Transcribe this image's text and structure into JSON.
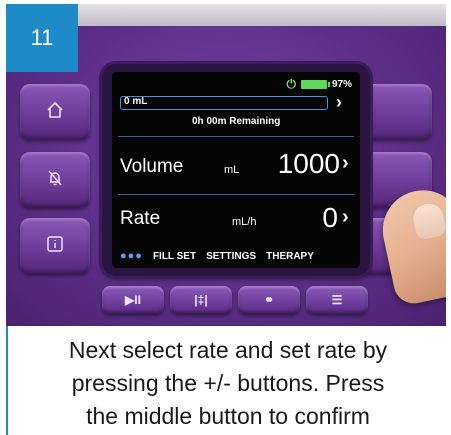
{
  "step": {
    "number": "11"
  },
  "status": {
    "battery_percent": "97%"
  },
  "infusion": {
    "progress_label": "0 mL",
    "progress_fraction": 0.0,
    "remaining_text": "0h 00m Remaining"
  },
  "volume": {
    "label": "Volume",
    "unit": "mL",
    "value": "1000",
    "arrow": "›"
  },
  "rate": {
    "label": "Rate",
    "unit": "mL/h",
    "value": "0",
    "arrow": "›"
  },
  "menu": {
    "dots": "●●●",
    "items": [
      "FILL SET",
      "SETTINGS",
      "THERAPY"
    ]
  },
  "left_buttons": [
    {
      "icon": "home-icon"
    },
    {
      "icon": "bell-off-icon"
    },
    {
      "icon": "info-icon"
    }
  ],
  "bottom_buttons": [
    {
      "icon": "play-pause-icon",
      "label": "▶II"
    },
    {
      "icon": "prime-icon",
      "label": "|‡|"
    },
    {
      "icon": "link-icon",
      "label": "⚭"
    },
    {
      "icon": "list-icon",
      "label": "☰"
    }
  ],
  "caption": {
    "lines": [
      "Next select rate and set rate by",
      "pressing the +/- buttons. Press",
      "the middle button to confirm"
    ]
  },
  "colors": {
    "device_purple": "#6a3a98",
    "screen_bg": "#050505",
    "accent_blue": "#1e8bc8",
    "battery_green": "#5ed85a"
  }
}
